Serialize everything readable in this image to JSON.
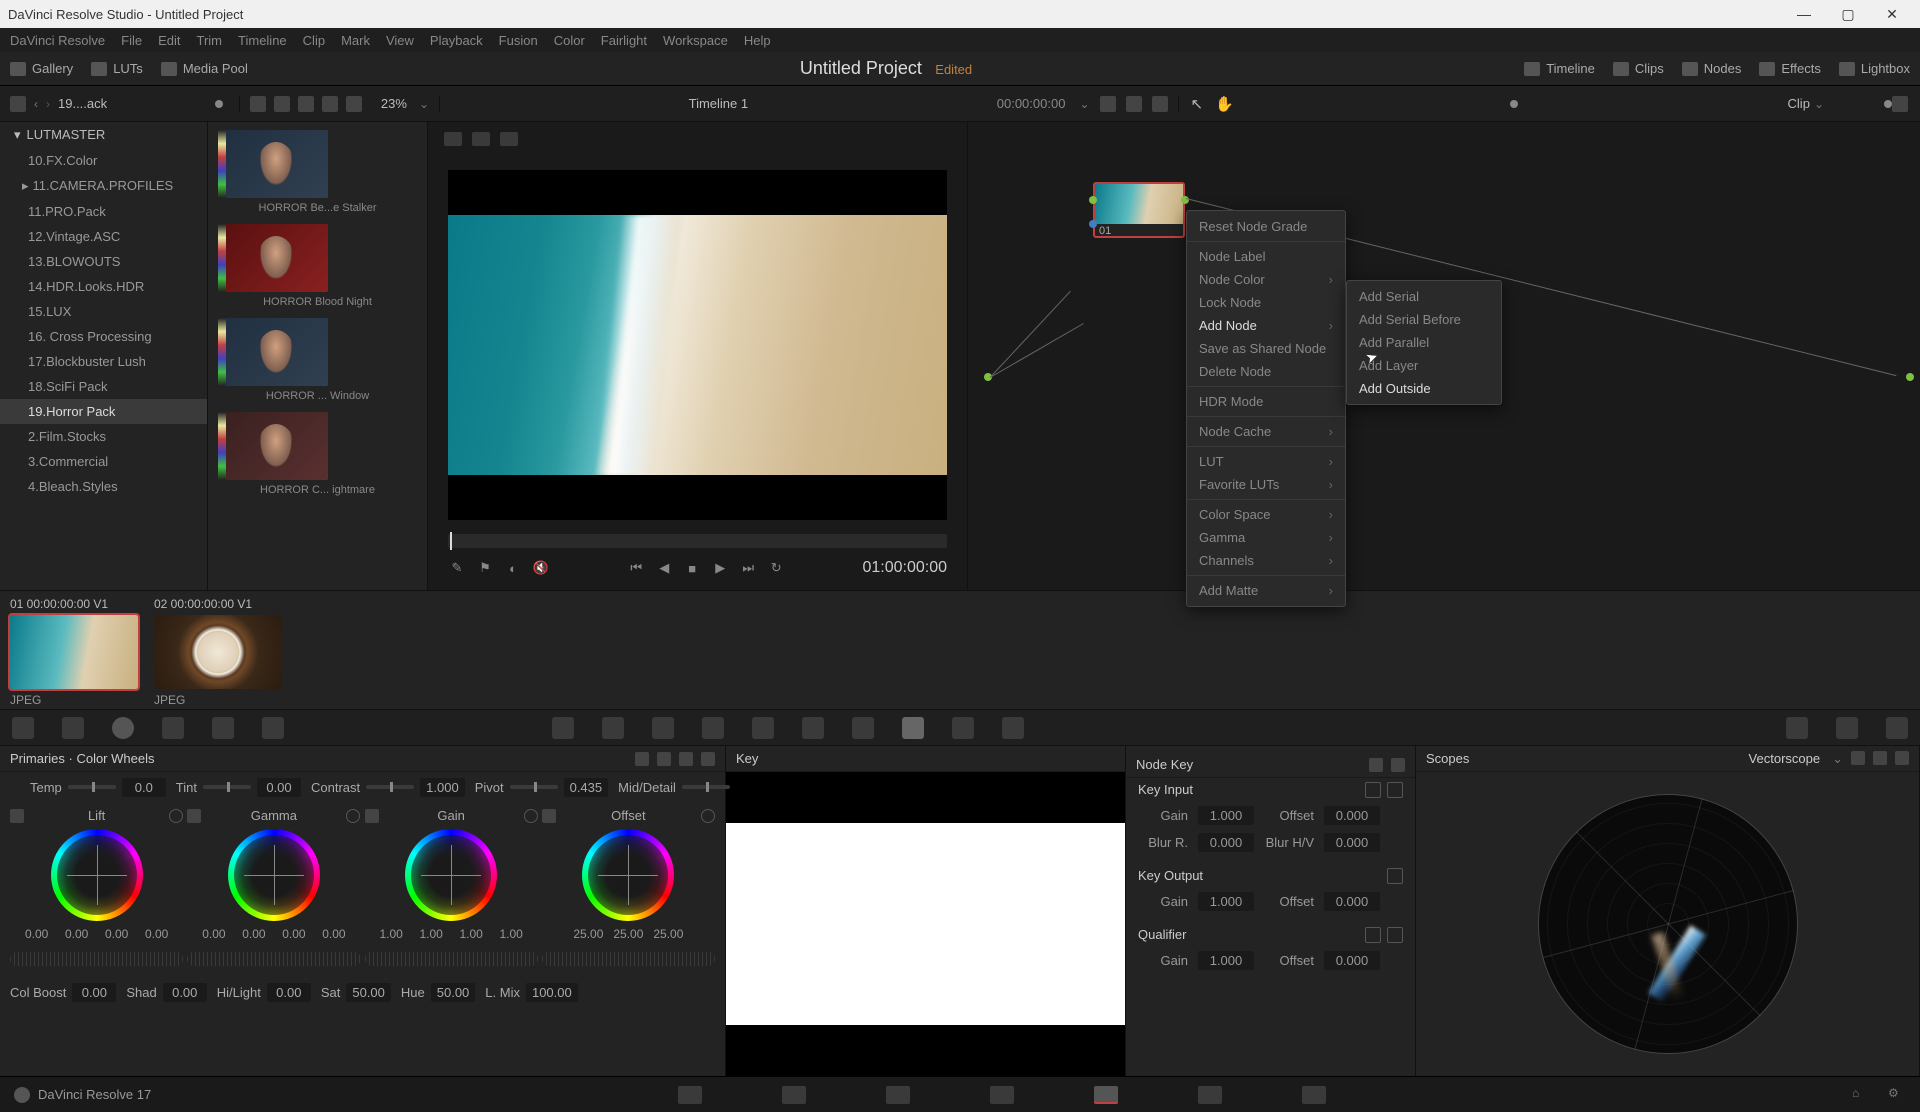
{
  "titlebar": "DaVinci Resolve Studio - Untitled Project",
  "menus": [
    "DaVinci Resolve",
    "File",
    "Edit",
    "Trim",
    "Timeline",
    "Clip",
    "Mark",
    "View",
    "Playback",
    "Fusion",
    "Color",
    "Fairlight",
    "Workspace",
    "Help"
  ],
  "toptabs": {
    "gallery": "Gallery",
    "luts": "LUTs",
    "mediapool": "Media Pool",
    "timeline": "Timeline",
    "clips": "Clips",
    "nodes": "Nodes",
    "effects": "Effects",
    "lightbox": "Lightbox"
  },
  "project": {
    "title": "Untitled Project",
    "status": "Edited"
  },
  "subhead": {
    "left": "19....ack",
    "zoom": "23%",
    "timeline": "Timeline 1",
    "tc": "00:00:00:00",
    "cliplabel": "Clip"
  },
  "tree": {
    "header": "LUTMASTER",
    "items": [
      {
        "label": "10.FX.Color"
      },
      {
        "label": "11.CAMERA.PROFILES",
        "expand": true
      },
      {
        "label": "11.PRO.Pack"
      },
      {
        "label": "12.Vintage.ASC"
      },
      {
        "label": "13.BLOWOUTS"
      },
      {
        "label": "14.HDR.Looks.HDR"
      },
      {
        "label": "15.LUX"
      },
      {
        "label": "16. Cross Processing"
      },
      {
        "label": "17.Blockbuster Lush"
      },
      {
        "label": "18.SciFi Pack"
      },
      {
        "label": "19.Horror Pack",
        "sel": true
      },
      {
        "label": "2.Film.Stocks"
      },
      {
        "label": "3.Commercial"
      },
      {
        "label": "4.Bleach.Styles"
      }
    ]
  },
  "luts": [
    {
      "name": "HORROR Be...e Stalker",
      "cls": "blue"
    },
    {
      "name": "HORROR Blood Night",
      "cls": "red"
    },
    {
      "name": "HORROR ... Window",
      "cls": "blue"
    },
    {
      "name": "HORROR C... ightmare",
      "cls": ""
    }
  ],
  "viewer": {
    "tc": "01:00:00:00"
  },
  "node": {
    "label": "01"
  },
  "ctx1": [
    {
      "l": "Reset Node Grade"
    },
    {
      "sep": true
    },
    {
      "l": "Node Label"
    },
    {
      "l": "Node Color",
      "sub": true
    },
    {
      "l": "Lock Node"
    },
    {
      "l": "Add Node",
      "sub": true,
      "hi": true
    },
    {
      "l": "Save as Shared Node"
    },
    {
      "l": "Delete Node"
    },
    {
      "sep": true
    },
    {
      "l": "HDR Mode"
    },
    {
      "sep": true
    },
    {
      "l": "Node Cache",
      "sub": true
    },
    {
      "sep": true
    },
    {
      "l": "LUT",
      "sub": true
    },
    {
      "l": "Favorite LUTs",
      "sub": true
    },
    {
      "sep": true
    },
    {
      "l": "Color Space",
      "sub": true
    },
    {
      "l": "Gamma",
      "sub": true
    },
    {
      "l": "Channels",
      "sub": true
    },
    {
      "sep": true
    },
    {
      "l": "Add Matte",
      "sub": true
    }
  ],
  "ctx2": [
    {
      "l": "Add Serial"
    },
    {
      "l": "Add Serial Before"
    },
    {
      "l": "Add Parallel"
    },
    {
      "l": "Add Layer"
    },
    {
      "l": "Add Outside",
      "hi": true
    }
  ],
  "clips": [
    {
      "meta": "01   00:00:00:00   V1",
      "lbl": "JPEG",
      "cls": "beach-sm",
      "sel": true
    },
    {
      "meta": "02   00:00:00:00   V1",
      "lbl": "JPEG",
      "cls": "coffee"
    }
  ],
  "primaries": {
    "title": "Primaries · Color Wheels",
    "row1": [
      {
        "l": "Temp",
        "v": "0.0"
      },
      {
        "l": "Tint",
        "v": "0.00"
      },
      {
        "l": "Contrast",
        "v": "1.000"
      },
      {
        "l": "Pivot",
        "v": "0.435"
      },
      {
        "l": "Mid/Detail",
        "v": "0.00"
      }
    ],
    "wheels": [
      {
        "name": "Lift",
        "v": [
          "0.00",
          "0.00",
          "0.00",
          "0.00"
        ]
      },
      {
        "name": "Gamma",
        "v": [
          "0.00",
          "0.00",
          "0.00",
          "0.00"
        ]
      },
      {
        "name": "Gain",
        "v": [
          "1.00",
          "1.00",
          "1.00",
          "1.00"
        ]
      },
      {
        "name": "Offset",
        "v": [
          "25.00",
          "25.00",
          "25.00"
        ]
      }
    ],
    "row2": [
      {
        "l": "Col Boost",
        "v": "0.00"
      },
      {
        "l": "Shad",
        "v": "0.00"
      },
      {
        "l": "Hi/Light",
        "v": "0.00"
      },
      {
        "l": "Sat",
        "v": "50.00"
      },
      {
        "l": "Hue",
        "v": "50.00"
      },
      {
        "l": "L. Mix",
        "v": "100.00"
      }
    ]
  },
  "key": {
    "title": "Key"
  },
  "nodekey": {
    "title": "Node Key",
    "input": {
      "title": "Key Input",
      "gain": "1.000",
      "offset": "0.000",
      "blurr": "0.000",
      "blurhv": "0.000"
    },
    "output": {
      "title": "Key Output",
      "gain": "1.000",
      "offset": "0.000"
    },
    "qual": {
      "title": "Qualifier",
      "gain": "1.000",
      "offset": "0.000"
    }
  },
  "scopes": {
    "title": "Scopes",
    "mode": "Vectorscope"
  },
  "footer": {
    "ver": "DaVinci Resolve 17"
  }
}
